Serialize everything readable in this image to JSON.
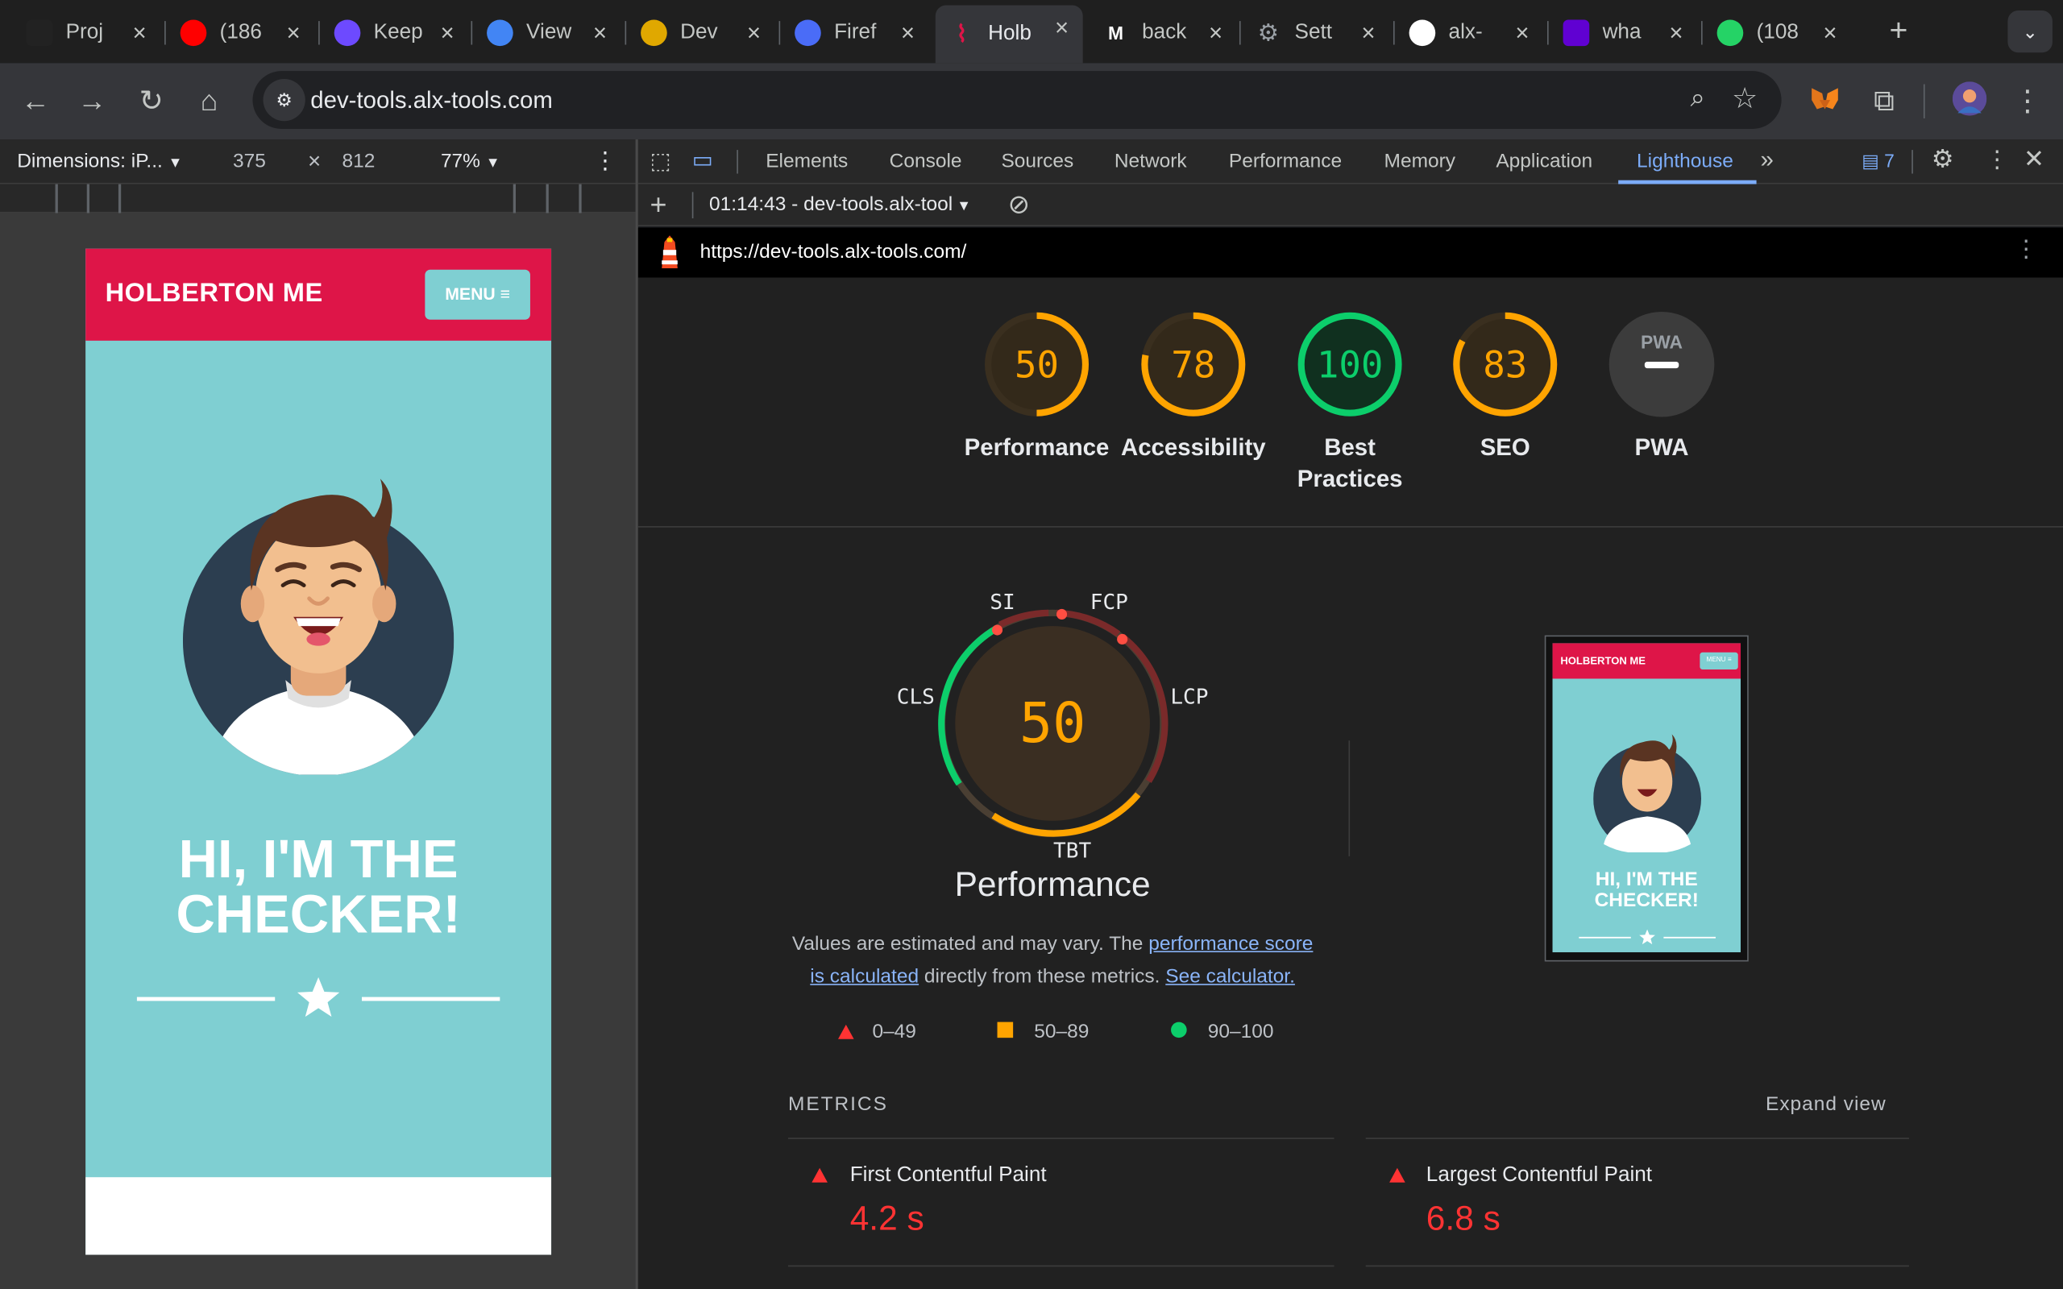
{
  "tabs": [
    {
      "title": "Proj",
      "icon": "alx-icon",
      "color": "#222222"
    },
    {
      "title": "(186",
      "icon": "youtube-icon",
      "color": "#ff0000"
    },
    {
      "title": "Keep",
      "icon": "proton-icon",
      "color": "#6d4aff"
    },
    {
      "title": "View",
      "icon": "chrome-icon",
      "color": "#4285f4"
    },
    {
      "title": "Dev",
      "icon": "udemy-icon",
      "color": "#e0a800"
    },
    {
      "title": "Firef",
      "icon": "firefox-icon",
      "color": "#4a6cf7"
    },
    {
      "title": "Holb",
      "icon": "holberton-icon",
      "color": "#de1548"
    },
    {
      "title": "back",
      "icon": "medium-icon",
      "color": "#000000"
    },
    {
      "title": "Sett",
      "icon": "gear-icon",
      "color": "#9aa0a6"
    },
    {
      "title": "alx-",
      "icon": "github-icon",
      "color": "#ffffff"
    },
    {
      "title": "wha",
      "icon": "yahoo-icon",
      "color": "#6001d2"
    },
    {
      "title": "(108",
      "icon": "whatsapp-icon",
      "color": "#25d366"
    }
  ],
  "toolbar": {
    "url": "dev-tools.alx-tools.com"
  },
  "device": {
    "dimensions_label": "Dimensions: iP...",
    "width": "375",
    "times": "×",
    "height": "812",
    "zoom": "77%"
  },
  "page": {
    "brand": "HOLBERTON ME",
    "menu_label": "MENU ≡",
    "headline_1": "HI, I'M THE",
    "headline_2": "CHECKER!"
  },
  "devtools": {
    "tabs": [
      "Elements",
      "Console",
      "Sources",
      "Network",
      "Performance",
      "Memory",
      "Application",
      "Lighthouse"
    ],
    "issues_count": "7",
    "report_selector": "01:14:43 - dev-tools.alx-tool",
    "report_url": "https://dev-tools.alx-tools.com/"
  },
  "scores": [
    {
      "label": "Performance",
      "value": 50,
      "color": "#ffa400"
    },
    {
      "label": "Accessibility",
      "value": 78,
      "color": "#ffa400"
    },
    {
      "label": "Best Practices",
      "value": 100,
      "color": "#0cce6b"
    },
    {
      "label": "SEO",
      "value": 83,
      "color": "#ffa400"
    },
    {
      "label": "PWA",
      "value": null,
      "color": "#9aa0a6"
    }
  ],
  "pwa_badge": "PWA",
  "perf_gauge": {
    "score": "50",
    "title": "Performance",
    "labels": {
      "si": "SI",
      "fcp": "FCP",
      "lcp": "LCP",
      "tbt": "TBT",
      "cls": "CLS"
    }
  },
  "perf_note": {
    "prefix": "Values are estimated and may vary. The ",
    "link1": "performance score is calculated",
    "middle": " directly from these metrics. ",
    "link2": "See calculator."
  },
  "legend": {
    "fail": "0–49",
    "average": "50–89",
    "pass": "90–100"
  },
  "thumbnail": {
    "brand": "HOLBERTON ME",
    "menu": "MENU ≡",
    "headline_1": "HI, I'M THE",
    "headline_2": "CHECKER!"
  },
  "metrics": {
    "header": "METRICS",
    "expand": "Expand view",
    "items": [
      {
        "name": "First Contentful Paint",
        "value": "4.2 s"
      },
      {
        "name": "Largest Contentful Paint",
        "value": "6.8 s"
      }
    ]
  }
}
